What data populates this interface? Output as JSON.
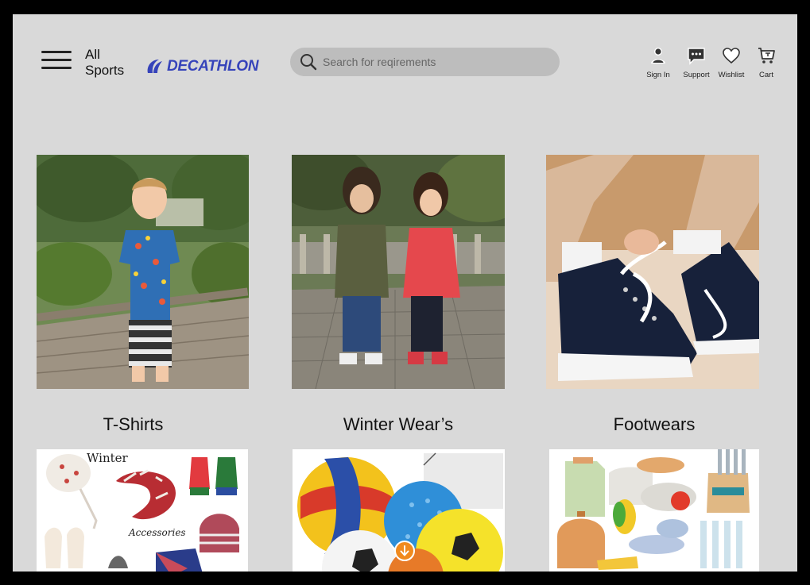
{
  "header": {
    "menu_label": "All Sports",
    "brand": "DECATHLON",
    "brand_color": "#3643ba",
    "search": {
      "placeholder": "Search for reqirements",
      "icon": "search-icon"
    },
    "actions": [
      {
        "label": "Sign In",
        "icon": "user-icon"
      },
      {
        "label": "Support",
        "icon": "chat-icon"
      },
      {
        "label": "Wishlist",
        "icon": "heart-icon"
      },
      {
        "label": "Cart",
        "icon": "cart-icon"
      }
    ]
  },
  "categories": [
    {
      "label": "T-Shirts"
    },
    {
      "label": "Winter Wear’s"
    },
    {
      "label": "Footwears"
    }
  ],
  "bottom_row": {
    "accessories_image_text": [
      "Winter",
      "Accessories"
    ]
  },
  "scroll_icon": "arrow-down-icon",
  "accent_color": "#f08a1e"
}
